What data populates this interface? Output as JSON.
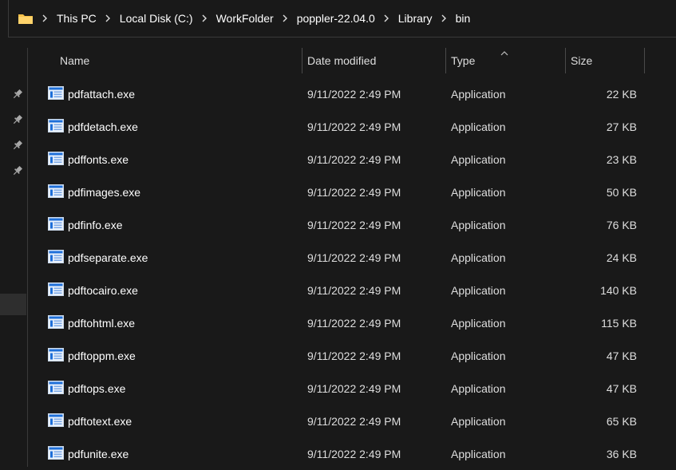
{
  "address_bar": {
    "icon": "folder-icon",
    "breadcrumbs": [
      "This PC",
      "Local Disk (C:)",
      "WorkFolder",
      "poppler-22.04.0",
      "Library",
      "bin"
    ]
  },
  "nav_pane": {
    "pins": [
      "pin-icon",
      "pin-icon",
      "pin-icon",
      "pin-icon"
    ]
  },
  "columns": {
    "name": "Name",
    "date_modified": "Date modified",
    "type": "Type",
    "size": "Size",
    "sort_indicator": "chevron-up-icon"
  },
  "files": [
    {
      "name": "pdfattach.exe",
      "date": "9/11/2022 2:49 PM",
      "type": "Application",
      "size": "22 KB"
    },
    {
      "name": "pdfdetach.exe",
      "date": "9/11/2022 2:49 PM",
      "type": "Application",
      "size": "27 KB"
    },
    {
      "name": "pdffonts.exe",
      "date": "9/11/2022 2:49 PM",
      "type": "Application",
      "size": "23 KB"
    },
    {
      "name": "pdfimages.exe",
      "date": "9/11/2022 2:49 PM",
      "type": "Application",
      "size": "50 KB"
    },
    {
      "name": "pdfinfo.exe",
      "date": "9/11/2022 2:49 PM",
      "type": "Application",
      "size": "76 KB"
    },
    {
      "name": "pdfseparate.exe",
      "date": "9/11/2022 2:49 PM",
      "type": "Application",
      "size": "24 KB"
    },
    {
      "name": "pdftocairo.exe",
      "date": "9/11/2022 2:49 PM",
      "type": "Application",
      "size": "140 KB"
    },
    {
      "name": "pdftohtml.exe",
      "date": "9/11/2022 2:49 PM",
      "type": "Application",
      "size": "115 KB"
    },
    {
      "name": "pdftoppm.exe",
      "date": "9/11/2022 2:49 PM",
      "type": "Application",
      "size": "47 KB"
    },
    {
      "name": "pdftops.exe",
      "date": "9/11/2022 2:49 PM",
      "type": "Application",
      "size": "47 KB"
    },
    {
      "name": "pdftotext.exe",
      "date": "9/11/2022 2:49 PM",
      "type": "Application",
      "size": "65 KB"
    },
    {
      "name": "pdfunite.exe",
      "date": "9/11/2022 2:49 PM",
      "type": "Application",
      "size": "36 KB"
    }
  ],
  "colors": {
    "background": "#191919",
    "text": "#ffffff",
    "secondary_text": "#dedede",
    "folder": "#f5c04a",
    "exe_icon_accent": "#1e6fd9"
  }
}
